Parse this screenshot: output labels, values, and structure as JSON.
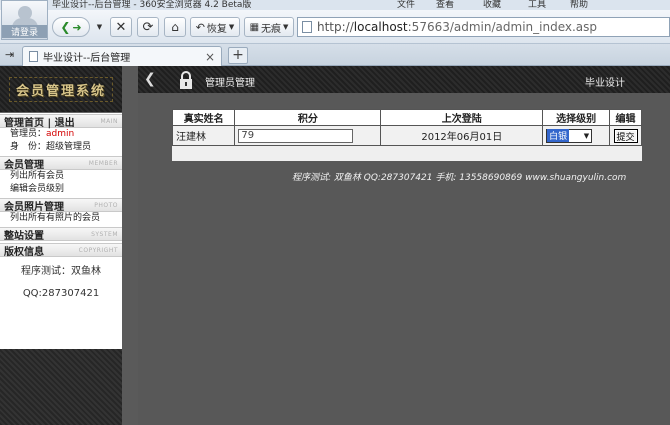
{
  "browser": {
    "window_title": "毕业设计--后台管理 - 360安全浏览器 4.2 Beta版",
    "menu": [
      "文件",
      "查看",
      "收藏",
      "工具",
      "帮助"
    ],
    "avatar_label": "请登录",
    "toolbar": {
      "restore_label": "恢复",
      "no_proxy_label": "无痕"
    },
    "address": {
      "scheme": "http://",
      "host": "localhost",
      "rest": ":57663/admin/admin_index.asp"
    },
    "tab_title": "毕业设计--后台管理",
    "tab_close": "×",
    "new_tab": "+"
  },
  "sidebar": {
    "logo": "会员管理系统",
    "sections": [
      {
        "title": "管理首页 | 退出",
        "en": "MAIN"
      },
      {
        "title": "会员管理",
        "en": "MEMBER"
      },
      {
        "title": "会员照片管理",
        "en": "PHOTO"
      },
      {
        "title": "整站设置",
        "en": "SYSTEM"
      },
      {
        "title": "版权信息",
        "en": "COPYRIGHT"
      }
    ],
    "admin_label": "管理员：",
    "admin_name": "admin",
    "identity_label": "身　份：",
    "identity_value": "超级管理员",
    "member_links": [
      "列出所有会员",
      "编辑会员级别"
    ],
    "photo_links": [
      "列出所有有照片的会员"
    ],
    "copyright_lines": [
      "程序测试：双鱼林",
      "QQ:287307421"
    ]
  },
  "main": {
    "title": "管理员管理",
    "right_title": "毕业设计",
    "table": {
      "headers": [
        "真实姓名",
        "积分",
        "上次登陆",
        "选择级别",
        "编辑"
      ],
      "rows": [
        {
          "name": "汪建林",
          "score": "79",
          "last_login": "2012年06月01日",
          "level": "白银",
          "action": "提交"
        }
      ]
    },
    "footer": "程序测试: 双鱼林  QQ:287307421  手机: 13558690869 www.shuangyulin.com"
  }
}
